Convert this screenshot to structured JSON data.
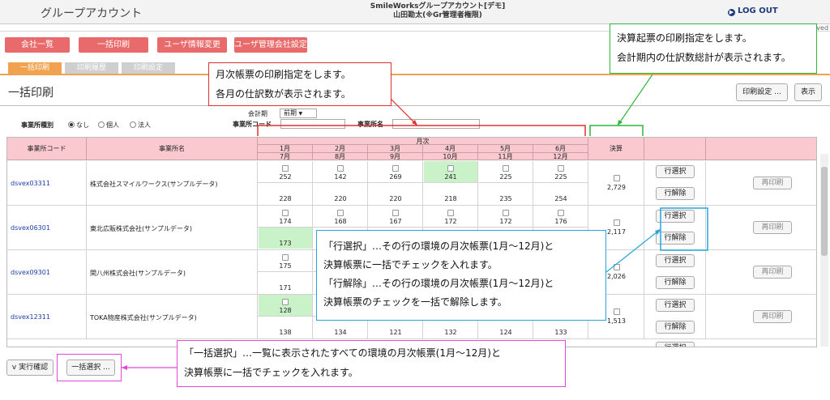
{
  "header": {
    "app_title": "グループアカウント",
    "account_line1": "SmileWorksグループアカウント[デモ]",
    "account_line2": "山田勘太(※Gr管理者権限)",
    "logout": "LOG OUT",
    "copyright_fragment": "rved"
  },
  "menu": [
    "会社一覧",
    "一括印刷",
    "ユーザ情報変更",
    "ユーザ管理会社設定"
  ],
  "tabs": [
    "一括印刷",
    "印刷履歴",
    "印刷設定"
  ],
  "page": {
    "title": "一括印刷",
    "print_settings_button": "印刷設定 ...",
    "display_button": "表示"
  },
  "filters": {
    "accounting_period_label": "会計期",
    "accounting_period_value": "前期",
    "entity_type_label": "事業所種別",
    "entity_type_options": [
      "なし",
      "個人",
      "法人"
    ],
    "entity_type_selected": "なし",
    "office_code_label": "事業所コード",
    "office_name_label": "事業所名"
  },
  "table": {
    "col_code": "事業所コード",
    "col_name": "事業所名",
    "col_monthly": "月次",
    "col_settlement": "決算",
    "months_top": [
      "1月",
      "2月",
      "3月",
      "4月",
      "5月",
      "6月"
    ],
    "months_bottom": [
      "7月",
      "8月",
      "9月",
      "10月",
      "11月",
      "12月"
    ],
    "row_select_label": "行選択",
    "row_clear_label": "行解除",
    "reprint_label": "再印刷",
    "rows": [
      {
        "code": "dsvex03311",
        "name": "株式会社スマイルワークス(サンプルデータ)",
        "top": [
          "252",
          "142",
          "269",
          "241",
          "225",
          "225"
        ],
        "bottom": [
          "228",
          "220",
          "220",
          "218",
          "235",
          "254"
        ],
        "settlement": "2,729"
      },
      {
        "code": "dsvex06301",
        "name": "東北広販株式会社(サンプルデータ)",
        "top": [
          "174",
          "168",
          "167",
          "172",
          "172",
          "176"
        ],
        "bottom": [
          "173",
          "",
          "",
          "",
          "",
          ""
        ],
        "settlement": "2,117"
      },
      {
        "code": "dsvex09301",
        "name": "関八州株式会社(サンプルデータ)",
        "top": [
          "175",
          "",
          "",
          "",
          "",
          ""
        ],
        "bottom": [
          "171",
          "",
          "",
          "",
          "",
          ""
        ],
        "settlement": "2,026"
      },
      {
        "code": "dsvex12311",
        "name": "TOKA物産株式会社(サンプルデータ)",
        "top": [
          "128",
          "",
          "",
          "",
          "",
          ""
        ],
        "bottom": [
          "138",
          "134",
          "121",
          "132",
          "124",
          "133"
        ],
        "settlement": "1,513"
      }
    ],
    "partial_row_button": "行選択"
  },
  "footer": {
    "execute_confirm": "v 実行確認",
    "select_all": "一括選択 ..."
  },
  "callouts": {
    "red": [
      "月次帳票の印刷指定をします。",
      "各月の仕訳数が表示されます。"
    ],
    "green": [
      "決算起票の印刷指定をします。",
      "会計期内の仕訳数総計が表示されます。"
    ],
    "blue": [
      "「行選択」…その行の環境の月次帳票(1月～12月)と",
      "決算帳票に一括でチェックを入れます。",
      "「行解除」…その行の環境の月次帳票(1月～12月)と",
      "決算帳票のチェックを一括で解除します。"
    ],
    "magenta": [
      "「一括選択」…一覧に表示されたすべての環境の月次帳票(1月～12月)と",
      "決算帳票に一括でチェックを入れます。"
    ]
  },
  "colors": {
    "menu": "#e96a6a",
    "tab_active": "#f0a24e",
    "header_pink": "#f9c9cf",
    "selected_cell": "#c9f2c9",
    "callout_red": "#e0312f",
    "callout_green": "#2db63a",
    "callout_blue": "#27a6dd",
    "callout_magenta": "#e247d6"
  }
}
